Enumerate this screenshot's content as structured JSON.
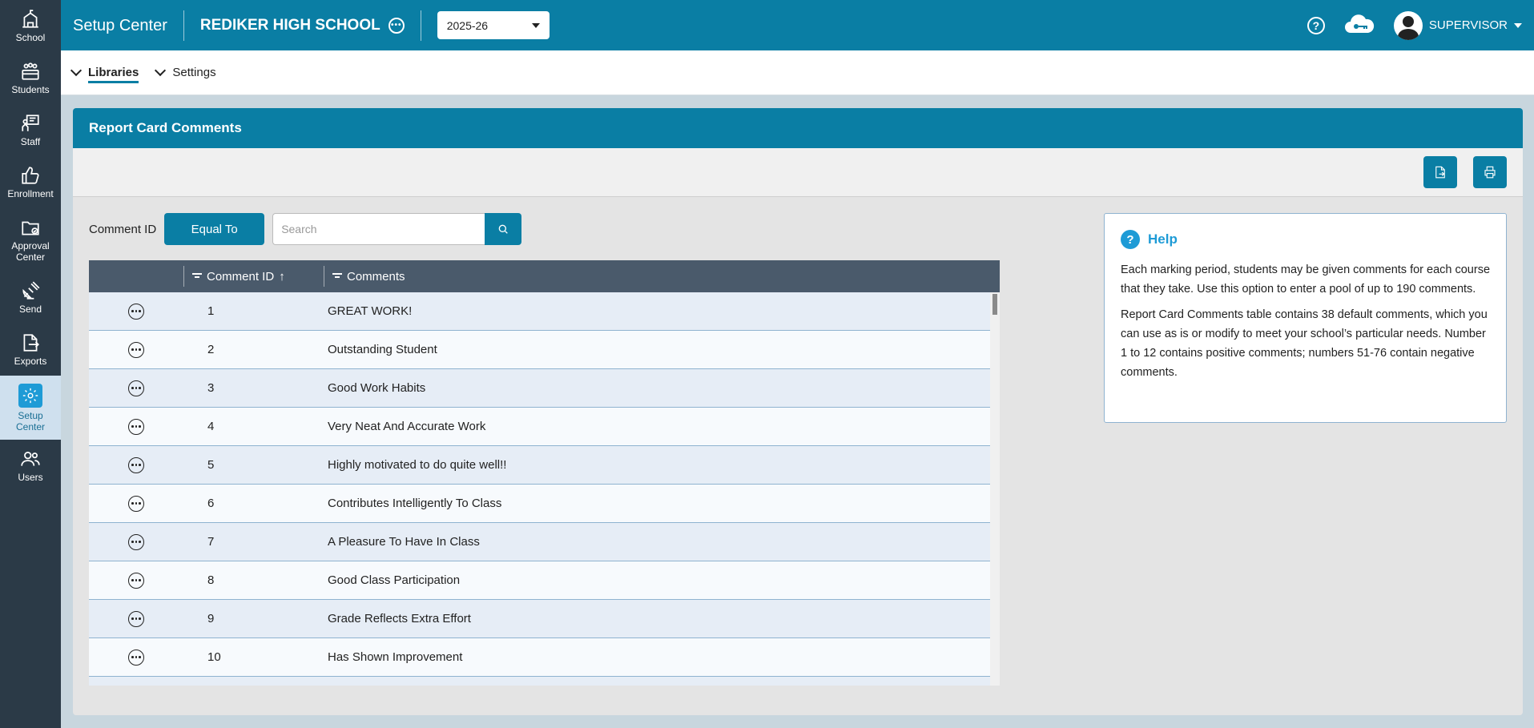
{
  "sidebar": {
    "items": [
      {
        "label": "School",
        "icon": "school-icon"
      },
      {
        "label": "Students",
        "icon": "students-icon"
      },
      {
        "label": "Staff",
        "icon": "staff-icon"
      },
      {
        "label": "Enrollment",
        "icon": "thumbs-up-icon"
      },
      {
        "label": "Approval Center",
        "icon": "folder-check-icon"
      },
      {
        "label": "Send",
        "icon": "satellite-icon"
      },
      {
        "label": "Exports",
        "icon": "export-icon"
      },
      {
        "label": "Setup Center",
        "icon": "gear-icon"
      },
      {
        "label": "Users",
        "icon": "users-icon"
      }
    ]
  },
  "header": {
    "app_title": "Setup Center",
    "school_name": "REDIKER HIGH SCHOOL",
    "year": "2025-26",
    "user": "SUPERVISOR"
  },
  "subnav": {
    "libraries": "Libraries",
    "settings": "Settings"
  },
  "panel": {
    "title": "Report Card Comments",
    "filter_label": "Comment ID",
    "operator": "Equal To",
    "search_placeholder": "Search"
  },
  "grid": {
    "columns": [
      "Comment ID",
      "Comments"
    ],
    "sort_indicator": "↑",
    "rows": [
      {
        "id": "1",
        "comment": "GREAT WORK!"
      },
      {
        "id": "2",
        "comment": "Outstanding Student"
      },
      {
        "id": "3",
        "comment": "Good Work Habits"
      },
      {
        "id": "4",
        "comment": "Very Neat And Accurate Work"
      },
      {
        "id": "5",
        "comment": "Highly motivated to do quite well!!"
      },
      {
        "id": "6",
        "comment": "Contributes Intelligently To Class"
      },
      {
        "id": "7",
        "comment": "A Pleasure To Have In Class"
      },
      {
        "id": "8",
        "comment": "Good Class Participation"
      },
      {
        "id": "9",
        "comment": "Grade Reflects Extra Effort"
      },
      {
        "id": "10",
        "comment": "Has Shown Improvement"
      },
      {
        "id": "",
        "comment": ""
      }
    ]
  },
  "help": {
    "title": "Help",
    "p1": "Each marking period, students may be given comments for each course that they take. Use this option to enter a pool of up to 190 comments.",
    "p2": "Report Card Comments table contains 38 default comments, which you can use as is or modify to meet your school’s particular needs. Number 1 to 12 contains positive comments; numbers 51-76 contain negative comments."
  },
  "colors": {
    "brand": "#0a7ea4",
    "sidebar": "#2b3a47",
    "grid_header": "#4a5a6b",
    "help_accent": "#1e9bd6"
  }
}
